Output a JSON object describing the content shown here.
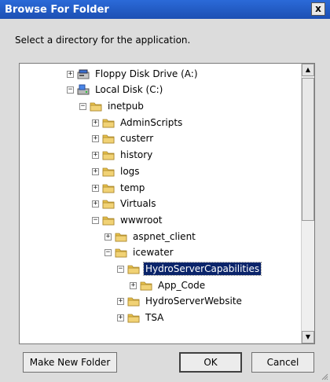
{
  "window": {
    "title": "Browse For Folder",
    "close_label": "x"
  },
  "prompt": "Select a directory for the application.",
  "tree": [
    {
      "label": "Floppy Disk Drive (A:)",
      "expander": "+",
      "icon": "floppy-drive-icon",
      "selected": false
    },
    {
      "label": "Local Disk (C:)",
      "expander": "−",
      "icon": "local-disk-icon",
      "selected": false
    },
    {
      "label": "inetpub",
      "expander": "−",
      "icon": "folder-icon",
      "selected": false
    },
    {
      "label": "AdminScripts",
      "expander": "+",
      "icon": "folder-icon",
      "selected": false
    },
    {
      "label": "custerr",
      "expander": "+",
      "icon": "folder-icon",
      "selected": false
    },
    {
      "label": "history",
      "expander": "+",
      "icon": "folder-icon",
      "selected": false
    },
    {
      "label": "logs",
      "expander": "+",
      "icon": "folder-icon",
      "selected": false
    },
    {
      "label": "temp",
      "expander": "+",
      "icon": "folder-icon",
      "selected": false
    },
    {
      "label": "Virtuals",
      "expander": "+",
      "icon": "folder-icon",
      "selected": false
    },
    {
      "label": "wwwroot",
      "expander": "−",
      "icon": "folder-icon",
      "selected": false
    },
    {
      "label": "aspnet_client",
      "expander": "+",
      "icon": "folder-icon",
      "selected": false
    },
    {
      "label": "icewater",
      "expander": "−",
      "icon": "folder-icon",
      "selected": false
    },
    {
      "label": "HydroServerCapabilities",
      "expander": "−",
      "icon": "folder-icon",
      "selected": true
    },
    {
      "label": "App_Code",
      "expander": "+",
      "icon": "folder-icon",
      "selected": false
    },
    {
      "label": "HydroServerWebsite",
      "expander": "+",
      "icon": "folder-icon",
      "selected": false
    },
    {
      "label": "TSA",
      "expander": "+",
      "icon": "folder-icon",
      "selected": false
    }
  ],
  "buttons": {
    "make_new_folder": "Make New Folder",
    "ok": "OK",
    "cancel": "Cancel"
  },
  "colors": {
    "title_bar": "#1c4fb3",
    "selection": "#0a246a",
    "folder": "#e8c14a"
  }
}
